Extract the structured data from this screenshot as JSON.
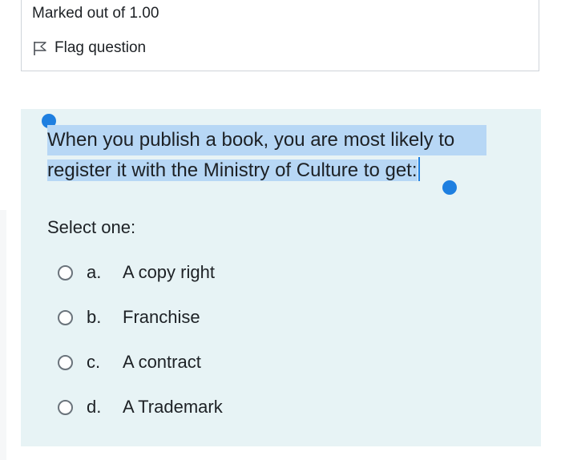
{
  "info": {
    "marked_out_of": "Marked out of 1.00",
    "flag_label": "Flag question"
  },
  "question": {
    "text_line1": "When you publish a book, you are most likely to",
    "text_line2": "register it with the Ministry of Culture to get:",
    "prompt": "Select one:",
    "selected_answer": null,
    "options": [
      {
        "letter": "a.",
        "text": "A copy right"
      },
      {
        "letter": "b.",
        "text": "Franchise"
      },
      {
        "letter": "c.",
        "text": "A contract"
      },
      {
        "letter": "d.",
        "text": "A Trademark"
      }
    ]
  },
  "colors": {
    "selection_highlight": "#b7d7f5",
    "selection_handle": "#1e7fe0",
    "question_background": "#e7f3f5"
  },
  "icons": {
    "flag": "flag-icon"
  }
}
